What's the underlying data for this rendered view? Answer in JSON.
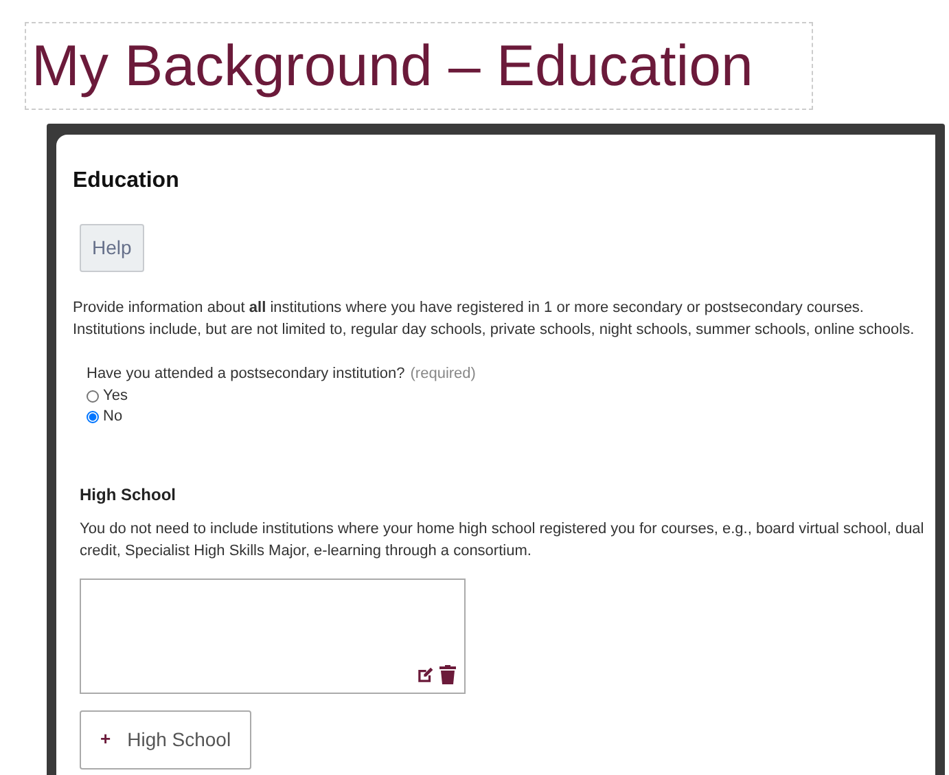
{
  "slide_title": "My Background – Education",
  "form": {
    "title": "Education",
    "help_button": "Help",
    "intro": "Provide information about **all** institutions where you have registered in 1 or more secondary or postsecondary courses. Institutions include, but are not limited to, regular day schools, private schools, night schools, summer schools, online schools.",
    "question": {
      "label": "Have you attended a postsecondary institution?",
      "required_note": "(required)",
      "options": [
        {
          "label": "Yes",
          "selected": false
        },
        {
          "label": "No",
          "selected": true
        }
      ]
    },
    "high_school": {
      "heading": "High School",
      "note": "You do not need to include institutions where your home high school registered you for courses, e.g., board virtual school, dual credit, Specialist High Skills Major, e-learning through a consortium.",
      "entries": [
        {
          "kind": "entry"
        }
      ],
      "add_button": {
        "icon": "+",
        "label": "High School"
      }
    }
  }
}
